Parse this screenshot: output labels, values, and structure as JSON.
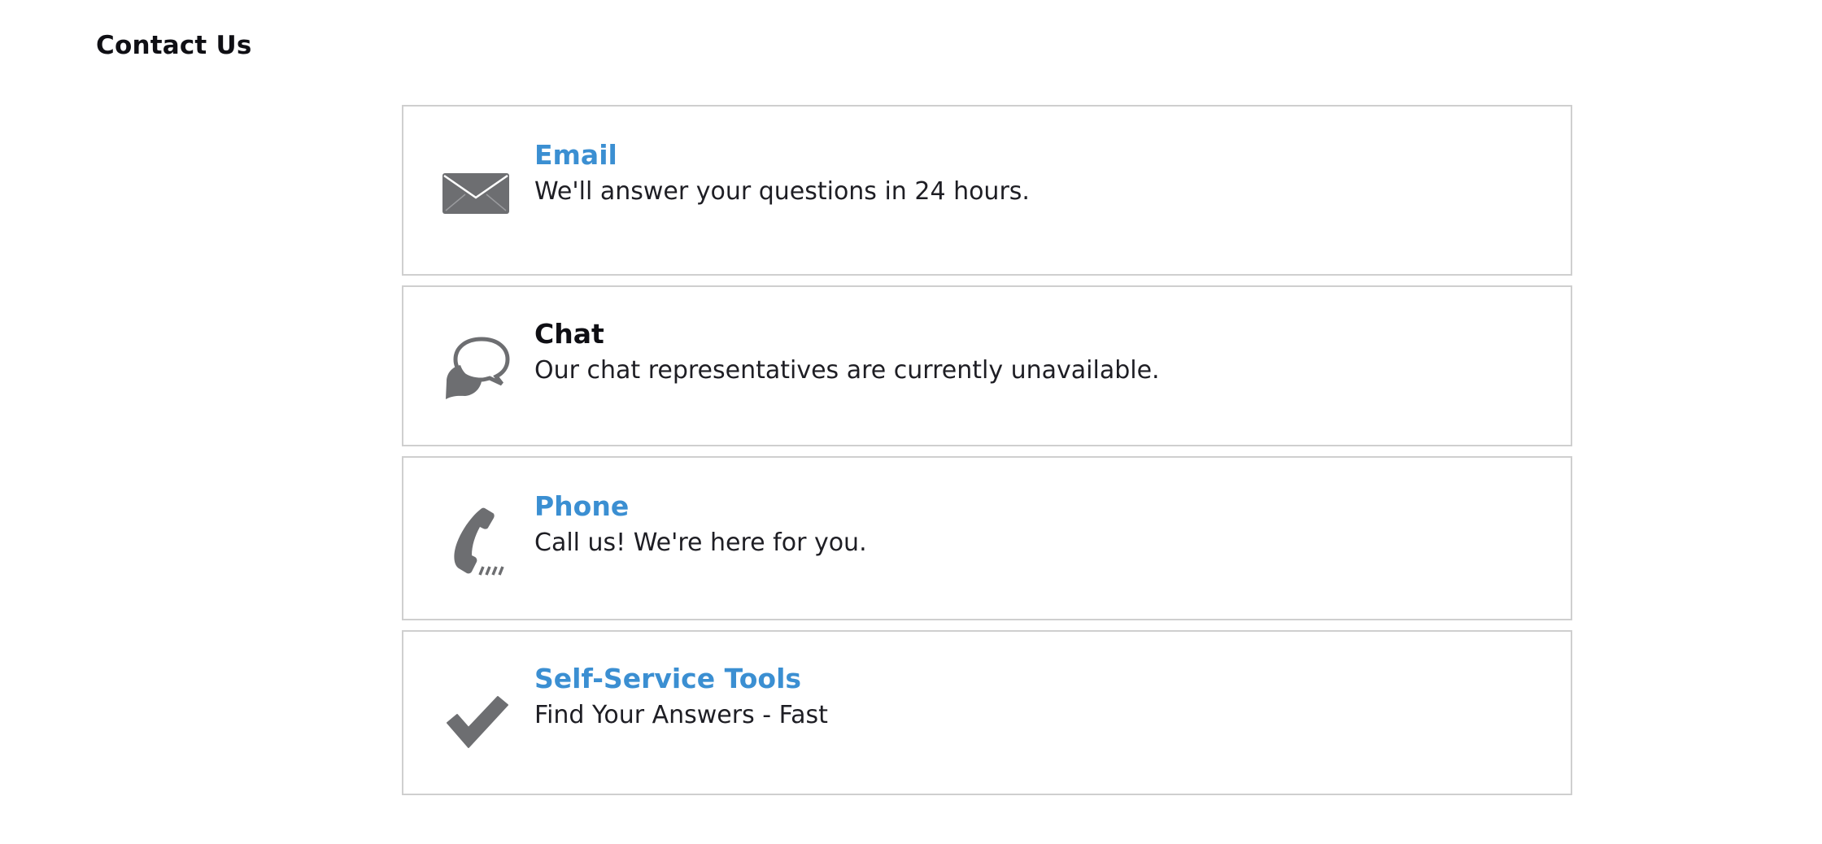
{
  "page": {
    "title": "Contact Us"
  },
  "colors": {
    "link": "#3b8fd2",
    "text": "#1e1e24",
    "icon": "#6d6e71",
    "border": "#cfcfcf"
  },
  "options": [
    {
      "key": "email",
      "icon": "envelope-icon",
      "title": "Email",
      "description": "We'll answer your questions in 24 hours."
    },
    {
      "key": "chat",
      "icon": "speech-bubbles-icon",
      "title": "Chat",
      "description": "Our chat representatives are currently unavailable."
    },
    {
      "key": "phone",
      "icon": "phone-icon",
      "title": "Phone",
      "description": "Call us! We're here for you."
    },
    {
      "key": "self-service",
      "icon": "checkmark-icon",
      "title": "Self-Service Tools",
      "description": "Find Your Answers - Fast"
    }
  ]
}
